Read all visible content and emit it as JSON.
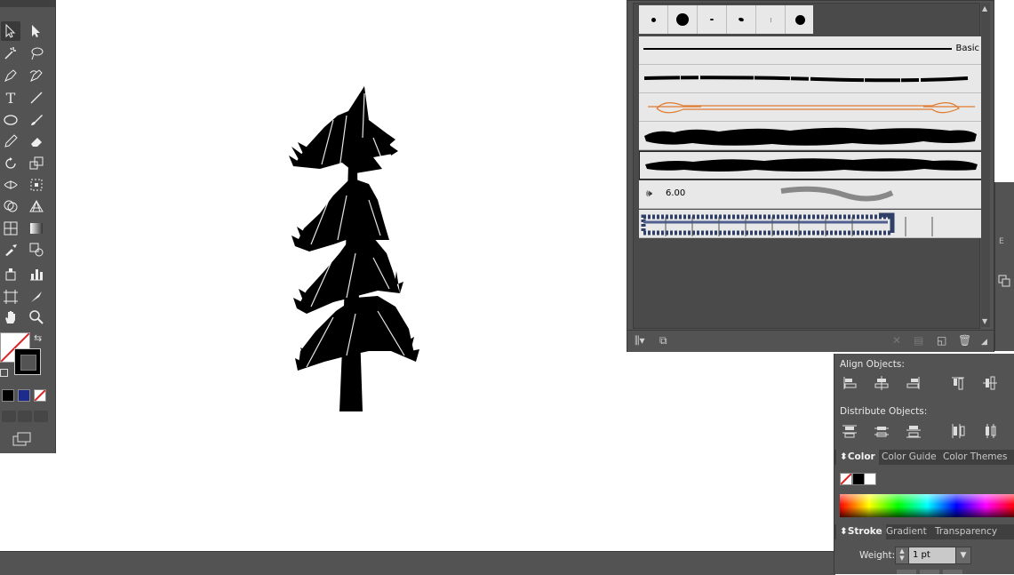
{
  "toolbar": {
    "tools": [
      "selection-tool",
      "direct-selection-tool",
      "magic-wand-tool",
      "lasso-tool",
      "pen-tool",
      "curvature-tool",
      "type-tool",
      "line-segment-tool",
      "ellipse-tool",
      "paintbrush-tool",
      "pencil-tool",
      "eraser-tool",
      "rotate-tool",
      "scale-tool",
      "width-tool",
      "free-transform-tool",
      "shape-builder-tool",
      "perspective-grid-tool",
      "mesh-tool",
      "gradient-tool",
      "eyedropper-tool",
      "blend-tool",
      "symbol-sprayer-tool",
      "column-graph-tool",
      "artboard-tool",
      "slice-tool",
      "hand-tool",
      "zoom-tool"
    ],
    "type_glyph": "T"
  },
  "brushes_panel": {
    "basic_label": "Basic",
    "bristle_size": "6.00",
    "accent_color": "#e07a2e"
  },
  "align_panel": {
    "align_title": "Align Objects:",
    "distribute_title": "Distribute Objects:"
  },
  "color_panel": {
    "tabs": [
      "Color",
      "Color Guide",
      "Color Themes"
    ]
  },
  "stroke_panel": {
    "tabs": [
      "Stroke",
      "Gradient",
      "Transparency"
    ],
    "weight_label": "Weight:",
    "weight_value": "1 pt"
  }
}
